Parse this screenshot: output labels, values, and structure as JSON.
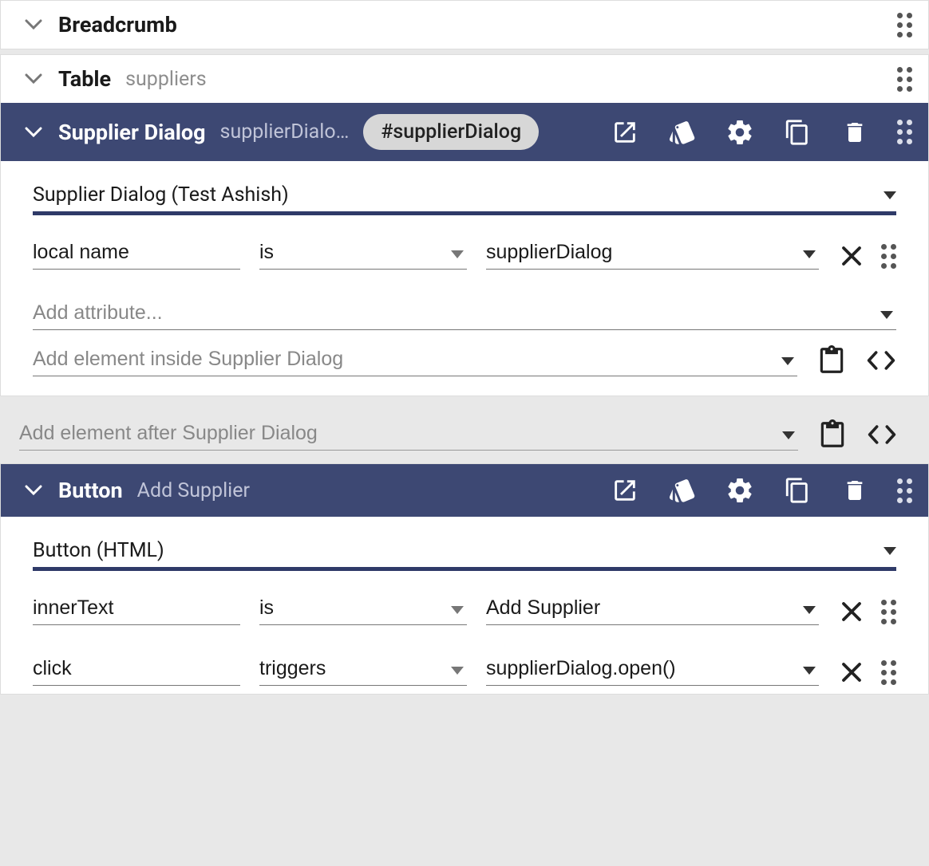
{
  "panels": {
    "breadcrumb": {
      "title": "Breadcrumb"
    },
    "table": {
      "title": "Table",
      "subtitle": "suppliers"
    },
    "supplierDialog": {
      "title": "Supplier Dialog",
      "subtitle": "supplierDialo…",
      "chip": "#supplierDialog",
      "typeSelect": "Supplier Dialog (Test Ashish)",
      "attrs": [
        {
          "name": "local name",
          "op": "is",
          "value": "supplierDialog"
        }
      ],
      "addAttrPlaceholder": "Add attribute...",
      "addInsidePlaceholder": "Add element inside Supplier Dialog"
    },
    "afterSupplier": {
      "placeholder": "Add element after Supplier Dialog"
    },
    "button": {
      "title": "Button",
      "subtitle": "Add Supplier",
      "typeSelect": "Button (HTML)",
      "attrs": [
        {
          "name": "innerText",
          "op": "is",
          "value": "Add Supplier"
        },
        {
          "name": "click",
          "op": "triggers",
          "value": "supplierDialog.open()"
        }
      ]
    }
  }
}
